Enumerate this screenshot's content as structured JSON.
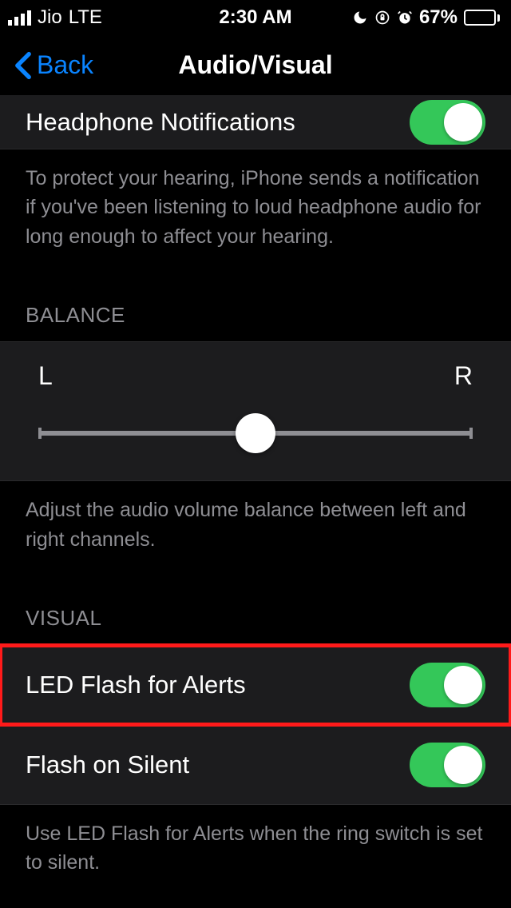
{
  "status": {
    "carrier": "Jio",
    "network": "LTE",
    "time": "2:30 AM",
    "batteryPercent": "67%"
  },
  "nav": {
    "back": "Back",
    "title": "Audio/Visual"
  },
  "headphone": {
    "label": "Headphone Notifications",
    "footer": "To protect your hearing, iPhone sends a notification if you've been listening to loud headphone audio for long enough to affect your hearing."
  },
  "balance": {
    "header": "BALANCE",
    "left": "L",
    "right": "R",
    "footer": "Adjust the audio volume balance between left and right channels."
  },
  "visual": {
    "header": "VISUAL",
    "ledFlash": "LED Flash for Alerts",
    "flashOnSilent": "Flash on Silent",
    "footer": "Use LED Flash for Alerts when the ring switch is set to silent."
  }
}
